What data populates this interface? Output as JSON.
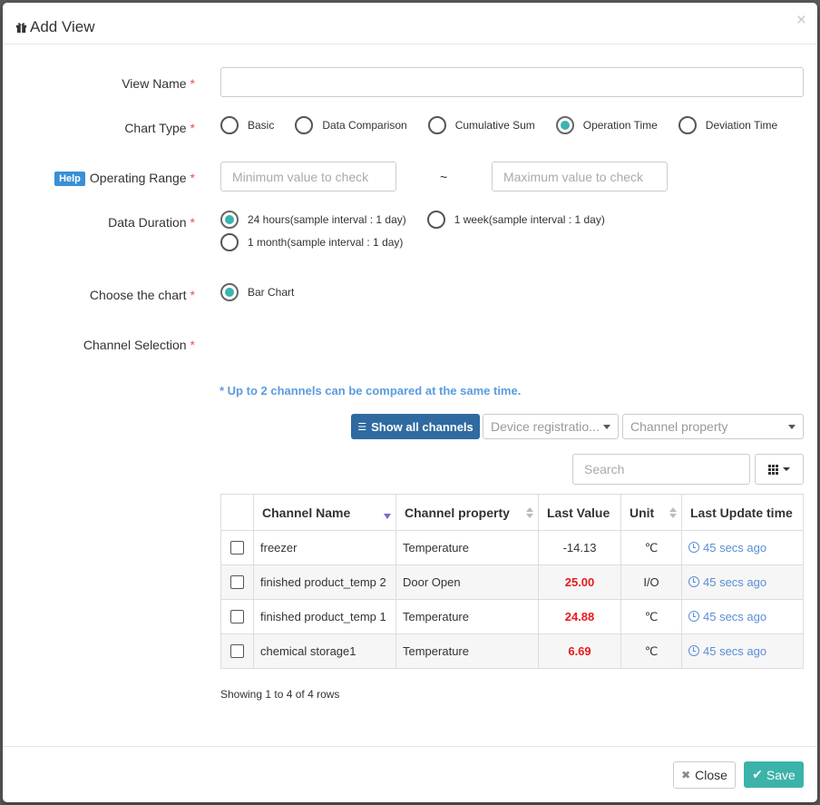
{
  "modal": {
    "title": "Add View",
    "close_glyph": "×"
  },
  "form": {
    "view_name": {
      "label": "View Name",
      "value": "",
      "placeholder": ""
    },
    "chart_type": {
      "label": "Chart Type",
      "options": [
        "Basic",
        "Data Comparison",
        "Cumulative Sum",
        "Operation Time",
        "Deviation Time"
      ],
      "selected": "Operation Time"
    },
    "operating_range": {
      "help": "Help",
      "label": "Operating Range",
      "min_placeholder": "Minimum value to check",
      "max_placeholder": "Maximum value to check",
      "separator": "~"
    },
    "data_duration": {
      "label": "Data Duration",
      "options": [
        "24 hours(sample interval : 1 day)",
        "1 week(sample interval : 1 day)",
        "1 month(sample interval : 1 day)"
      ],
      "selected": "24 hours(sample interval : 1 day)"
    },
    "choose_chart": {
      "label": "Choose the chart",
      "options": [
        "Bar Chart"
      ],
      "selected": "Bar Chart"
    },
    "channel_selection": {
      "label": "Channel Selection"
    },
    "required_mark": "*"
  },
  "channels": {
    "note": "* Up to 2 channels can be compared at the same time.",
    "show_all_label": "Show all channels",
    "device_select": "Device registratio...",
    "property_select": "Channel property",
    "search_placeholder": "Search",
    "columns": [
      "Channel Name",
      "Channel property",
      "Last Value",
      "Unit",
      "Last Update time"
    ],
    "rows": [
      {
        "name": "freezer",
        "property": "Temperature",
        "value": "-14.13",
        "unit": "℃",
        "time": "45 secs ago"
      },
      {
        "name": "finished product_temp 2",
        "property": "Door Open",
        "value": "25.00",
        "unit": "I/O",
        "time": "45 secs ago"
      },
      {
        "name": "finished product_temp 1",
        "property": "Temperature",
        "value": "24.88",
        "unit": "℃",
        "time": "45 secs ago"
      },
      {
        "name": "chemical storage1",
        "property": "Temperature",
        "value": "6.69",
        "unit": "℃",
        "time": "45 secs ago"
      }
    ],
    "showing": "Showing 1 to 4 of 4 rows"
  },
  "footer": {
    "close_label": "Close",
    "save_label": "Save"
  },
  "colors": {
    "primary": "#2f6ba0",
    "save": "#3bb3a9",
    "radio_dot": "#3bb3b0",
    "alert_value": "#e81b1b",
    "link": "#5b8ed6"
  }
}
